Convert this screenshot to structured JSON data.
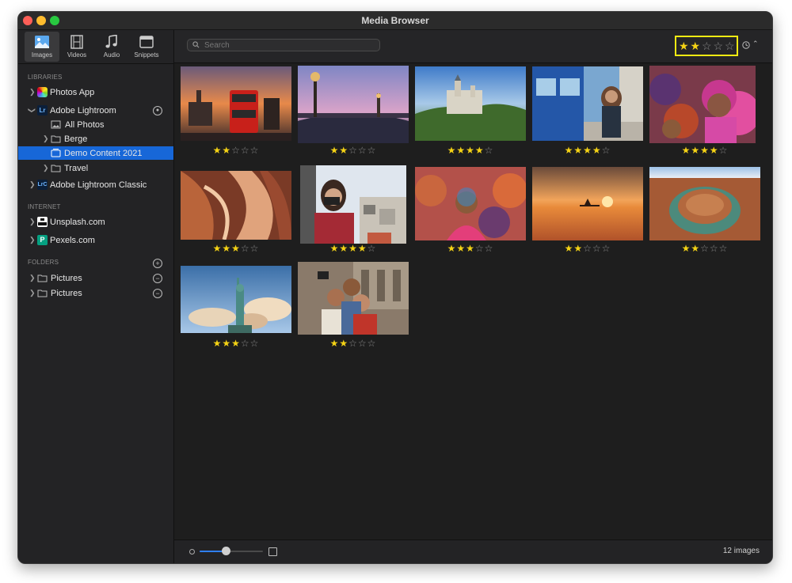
{
  "window": {
    "title": "Media Browser"
  },
  "tabs": [
    {
      "label": "Images",
      "icon": "images-icon",
      "active": true
    },
    {
      "label": "Videos",
      "icon": "film-icon"
    },
    {
      "label": "Audio",
      "icon": "music-note-icon"
    },
    {
      "label": "Snippets",
      "icon": "window-icon"
    }
  ],
  "sidebar": {
    "libraries_header": "LIBRARIES",
    "libraries": {
      "photos_app": "Photos App",
      "adobe_lightroom": "Adobe Lightroom",
      "lightroom_badge": "Lr",
      "all_photos": "All Photos",
      "berge": "Berge",
      "demo_content": "Demo Content 2021",
      "travel": "Travel",
      "lightroom_classic": "Adobe Lightroom Classic",
      "classic_badge": "LrC"
    },
    "internet_header": "INTERNET",
    "internet": {
      "unsplash": "Unsplash.com",
      "pexels": "Pexels.com"
    },
    "folders_header": "FOLDERS",
    "folders": [
      "Pictures",
      "Pictures"
    ]
  },
  "search": {
    "placeholder": "Search",
    "value": ""
  },
  "rating_filter": {
    "value": 2,
    "max": 5,
    "highlight_color": "#f2ea12"
  },
  "images": [
    {
      "rating": 2,
      "scene": "london-bus-sunset"
    },
    {
      "rating": 2,
      "scene": "paris-bridge-dusk"
    },
    {
      "rating": 4,
      "scene": "castle-landscape"
    },
    {
      "rating": 4,
      "scene": "woman-blue-train"
    },
    {
      "rating": 4,
      "scene": "holi-festival-girl"
    },
    {
      "rating": 3,
      "scene": "antelope-canyon"
    },
    {
      "rating": 4,
      "scene": "woman-camera-balcony"
    },
    {
      "rating": 3,
      "scene": "holi-festival-woman"
    },
    {
      "rating": 2,
      "scene": "sunset-paddleboard"
    },
    {
      "rating": 2,
      "scene": "horseshoe-bend"
    },
    {
      "rating": 3,
      "scene": "statue-of-liberty"
    },
    {
      "rating": 2,
      "scene": "friends-selfie"
    }
  ],
  "footer": {
    "count": "12 images",
    "zoom": 0.42
  },
  "colors": {
    "accent": "#1767d8",
    "star": "#f5d315",
    "background": "#1e1e1e"
  }
}
